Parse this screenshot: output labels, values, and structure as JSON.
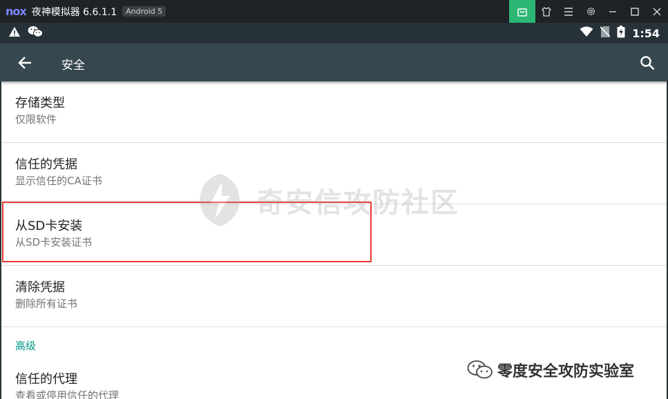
{
  "window": {
    "logo": "nox",
    "title": "夜神模拟器 6.6.1.1",
    "android_badge": "Android 5",
    "controls": [
      "store-icon",
      "shirt-icon",
      "menu-icon",
      "gear-icon",
      "minimize-icon",
      "maximize-icon",
      "close-icon"
    ]
  },
  "statusbar": {
    "left_icons": [
      "warning-icon",
      "wechat-icon"
    ],
    "right_icons": [
      "wifi-icon",
      "no-sim-icon",
      "battery-charging-icon"
    ],
    "time": "1:54"
  },
  "actionbar": {
    "title": "安全"
  },
  "preferences": [
    {
      "title": "存储类型",
      "summary": "仅限软件"
    },
    {
      "title": "信任的凭据",
      "summary": "显示信任的CA证书"
    },
    {
      "title": "从SD卡安装",
      "summary": "从SD卡安装证书"
    },
    {
      "title": "清除凭据",
      "summary": "删除所有证书"
    }
  ],
  "advanced": {
    "header": "高级",
    "items": [
      {
        "title": "信任的代理",
        "summary": "查看或停用信任的代理"
      }
    ]
  },
  "watermarks": {
    "center": "奇安信攻防社区",
    "corner": "零度安全攻防实验室"
  },
  "colors": {
    "statusbar": "#263238",
    "actionbar": "#37474f",
    "accent": "#009688",
    "highlight": "#e53935",
    "store": "#2bb673"
  }
}
